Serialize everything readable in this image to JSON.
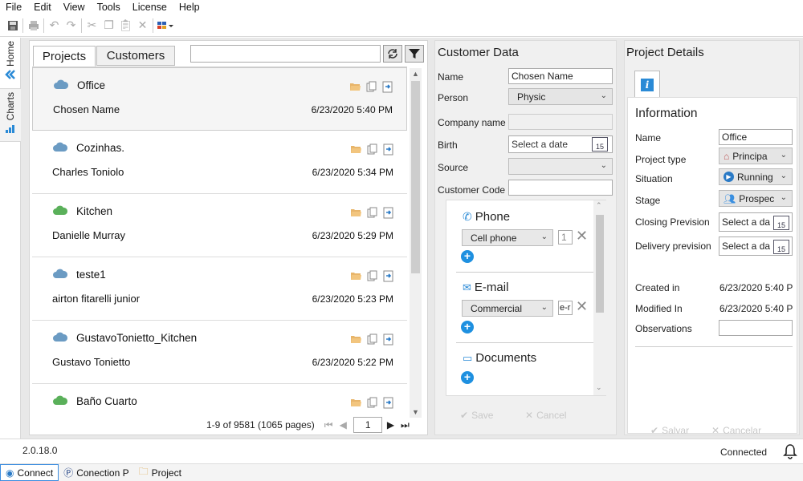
{
  "menu": [
    "File",
    "Edit",
    "View",
    "Tools",
    "License",
    "Help"
  ],
  "sidetabs": {
    "home": "Home",
    "charts": "Charts"
  },
  "projects_panel": {
    "tabs": [
      "Projects",
      "Customers"
    ],
    "search_value": "",
    "items": [
      {
        "project": "Office",
        "customer": "Chosen Name",
        "date": "6/23/2020 5:40 PM",
        "cloud_color": "#6b9bc3",
        "selected": true
      },
      {
        "project": "Cozinhas.",
        "customer": "Charles Toniolo",
        "date": "6/23/2020 5:34 PM",
        "cloud_color": "#6b9bc3"
      },
      {
        "project": "Kitchen",
        "customer": "Danielle Murray",
        "date": "6/23/2020 5:29 PM",
        "cloud_color": "#5ab05a"
      },
      {
        "project": "teste1",
        "customer": "airton fitarelli junior",
        "date": "6/23/2020 5:23 PM",
        "cloud_color": "#6b9bc3"
      },
      {
        "project": "GustavoTonietto_Kitchen",
        "customer": "Gustavo Tonietto",
        "date": "6/23/2020 5:22 PM",
        "cloud_color": "#6b9bc3"
      },
      {
        "project": "Baño Cuarto",
        "customer": "",
        "date": "",
        "cloud_color": "#5ab05a"
      }
    ],
    "pager_text": "1-9 of 9581 (1065 pages)",
    "page_value": "1"
  },
  "customer": {
    "title": "Customer Data",
    "name_label": "Name",
    "name_value": "Chosen Name",
    "person_label": "Person",
    "person_value": "Physic",
    "company_label": "Company name",
    "company_value": "",
    "birth_label": "Birth",
    "birth_placeholder": "Select a date",
    "source_label": "Source",
    "source_value": "",
    "code_label": "Customer Code",
    "code_value": "",
    "phone_title": "Phone",
    "phone_type": "Cell phone",
    "phone_value": "1",
    "email_title": "E-mail",
    "email_type": "Commercial",
    "email_value": "e-r",
    "documents_title": "Documents",
    "save_label": "Save",
    "cancel_label": "Cancel",
    "cal_day": "15"
  },
  "details": {
    "title": "Project Details",
    "info_title": "Information",
    "name_label": "Name",
    "name_value": "Office",
    "type_label": "Project type",
    "type_value": "Principa",
    "situation_label": "Situation",
    "situation_value": "Running",
    "stage_label": "Stage",
    "stage_value": "Prospec",
    "closing_label": "Closing Prevision",
    "closing_placeholder": "Select a da",
    "delivery_label": "Delivery prevision",
    "delivery_placeholder": "Select a da",
    "created_label": "Created in",
    "created_value": "6/23/2020 5:40 P",
    "modified_label": "Modified In",
    "modified_value": "6/23/2020 5:40 P",
    "obs_label": "Observations",
    "obs_value": "",
    "save_label": "Salvar",
    "cancel_label": "Cancelar"
  },
  "status": {
    "version": "2.0.18.0",
    "connection": "Connected"
  },
  "taskbar": [
    "Connect",
    "Conection P",
    "Project"
  ]
}
